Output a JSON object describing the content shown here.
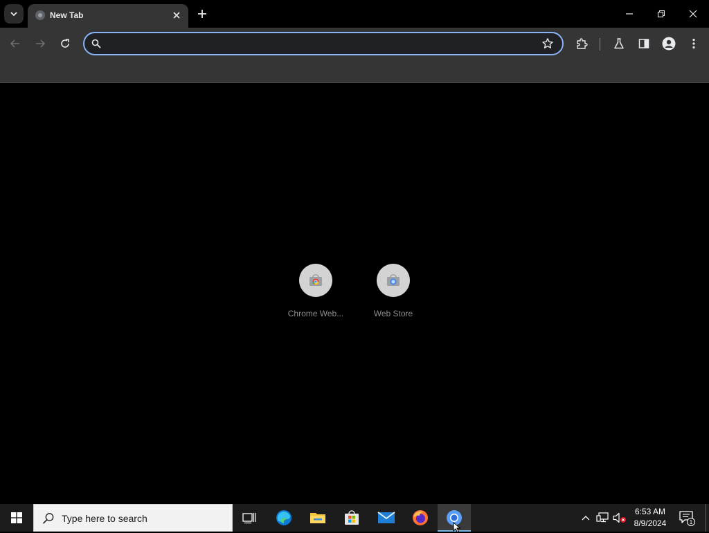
{
  "browser": {
    "tab": {
      "title": "New Tab"
    },
    "omnibox": {
      "value": "",
      "placeholder": ""
    }
  },
  "new_tab_page": {
    "shortcuts": [
      {
        "label": "Chrome Web...",
        "icon": "chrome-web-store-icon"
      },
      {
        "label": "Web Store",
        "icon": "web-store-icon"
      }
    ]
  },
  "taskbar": {
    "search_placeholder": "Type here to search",
    "apps": [
      "task-view",
      "edge",
      "file-explorer",
      "microsoft-store",
      "mail",
      "firefox",
      "chrome"
    ],
    "active_app": "chrome",
    "clock": {
      "time": "6:53 AM",
      "date": "8/9/2024"
    },
    "notification_count": "1"
  },
  "colors": {
    "accent": "#8ab4f8",
    "toolbar": "#353535",
    "taskbar": "#1c1c1c",
    "taskbar_active_underline": "#76b9ed"
  }
}
